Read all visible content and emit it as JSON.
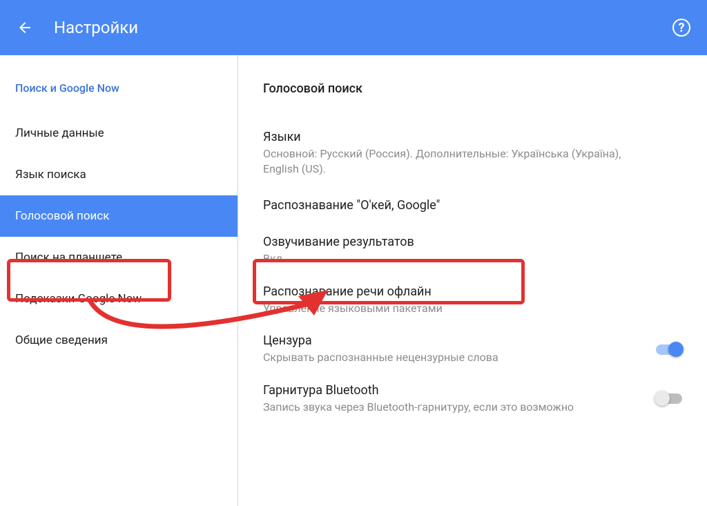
{
  "header": {
    "title": "Настройки"
  },
  "sidebar": {
    "section": "Поиск и Google Now",
    "items": [
      {
        "label": "Личные данные",
        "active": false
      },
      {
        "label": "Язык поиска",
        "active": false
      },
      {
        "label": "Голосовой поиск",
        "active": true
      },
      {
        "label": "Поиск на планшете",
        "active": false
      },
      {
        "label": "Подсказки Google Now",
        "active": false
      },
      {
        "label": "Общие сведения",
        "active": false
      }
    ]
  },
  "main": {
    "title": "Голосовой поиск",
    "settings": [
      {
        "title": "Языки",
        "sub": "Основной: Русский (Россия). Дополнительные: Українська (Україна), English (US).",
        "toggle": null
      },
      {
        "title": "Распознавание \"О'кей, Google\"",
        "sub": "",
        "toggle": null
      },
      {
        "title": "Озвучивание результатов",
        "sub": "Вкл.",
        "toggle": null
      },
      {
        "title": "Распознавание речи офлайн",
        "sub": "Управление языковыми пакетами",
        "toggle": null
      },
      {
        "title": "Цензура",
        "sub": "Скрывать распознанные нецензурные слова",
        "toggle": true
      },
      {
        "title": "Гарнитура Bluetooth",
        "sub": "Запись звука через Bluetooth-гарнитуру, если это возможно",
        "toggle": false
      }
    ]
  }
}
